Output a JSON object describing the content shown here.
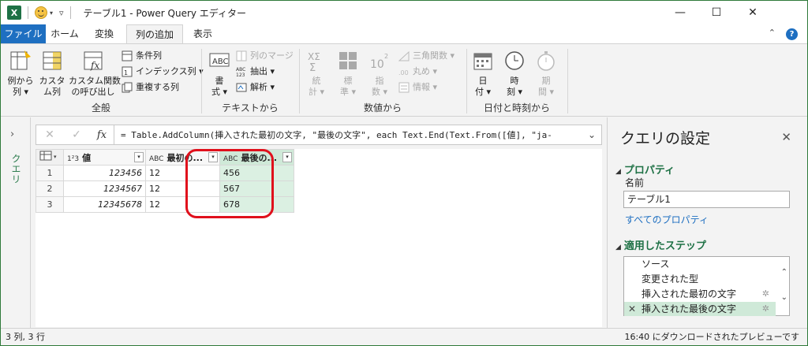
{
  "titlebar": {
    "app_icon": "excel-icon",
    "title": "テーブル1 - Power Query エディター",
    "minimize": "—",
    "maximize": "☐",
    "close": "✕"
  },
  "tabs": {
    "file": "ファイル",
    "home": "ホーム",
    "transform": "変換",
    "add_column": "列の追加",
    "view": "表示",
    "help": "?"
  },
  "ribbon": {
    "general": {
      "label": "全般",
      "example_col": "例から\n列 ▾",
      "custom_col": "カスタ\nム列",
      "invoke_fn": "カスタム関数\nの呼び出し",
      "conditional_col": "条件列",
      "index_col": "インデックス列 ▾",
      "duplicate_col": "重複する列"
    },
    "text": {
      "label": "テキストから",
      "format": "書\n式 ▾",
      "merge_cols": "列のマージ",
      "extract": "抽出 ▾",
      "parse": "解析 ▾"
    },
    "number": {
      "label": "数値から",
      "statistics": "統\n計 ▾",
      "standard": "標\n準 ▾",
      "scientific": "指\n数 ▾",
      "trig": "三角関数 ▾",
      "rounding": "丸め ▾",
      "info": "情報 ▾"
    },
    "datetime": {
      "label": "日付と時刻から",
      "date": "日\n付 ▾",
      "time": "時\n刻 ▾",
      "duration": "期\n間 ▾"
    }
  },
  "query_pane": {
    "label": "クエリ"
  },
  "formula": {
    "text": "= Table.AddColumn(挿入された最初の文字, \"最後の文字\", each Text.End(Text.From([値], \"ja-"
  },
  "grid": {
    "columns": [
      {
        "type": "1²3",
        "name": "値"
      },
      {
        "type": "ABC",
        "name": "最初の..."
      },
      {
        "type": "ABC",
        "name": "最後の..."
      }
    ],
    "rows": [
      {
        "n": "1",
        "v": "123456",
        "first": "12",
        "last": "456"
      },
      {
        "n": "2",
        "v": "1234567",
        "first": "12",
        "last": "567"
      },
      {
        "n": "3",
        "v": "12345678",
        "first": "12",
        "last": "678"
      }
    ]
  },
  "settings": {
    "title": "クエリの設定",
    "properties": "プロパティ",
    "name_label": "名前",
    "name_value": "テーブル1",
    "all_properties": "すべてのプロパティ",
    "applied_steps": "適用したステップ",
    "steps": [
      "ソース",
      "変更された型",
      "挿入された最初の文字",
      "挿入された最後の文字"
    ]
  },
  "status": {
    "left": "3 列, 3 行",
    "right": "16:40 にダウンロードされたプレビューです"
  },
  "colors": {
    "accent": "#1e7145",
    "file_tab": "#1e6fc1",
    "highlight": "#e0101c",
    "selected": "#cfe9d8"
  }
}
